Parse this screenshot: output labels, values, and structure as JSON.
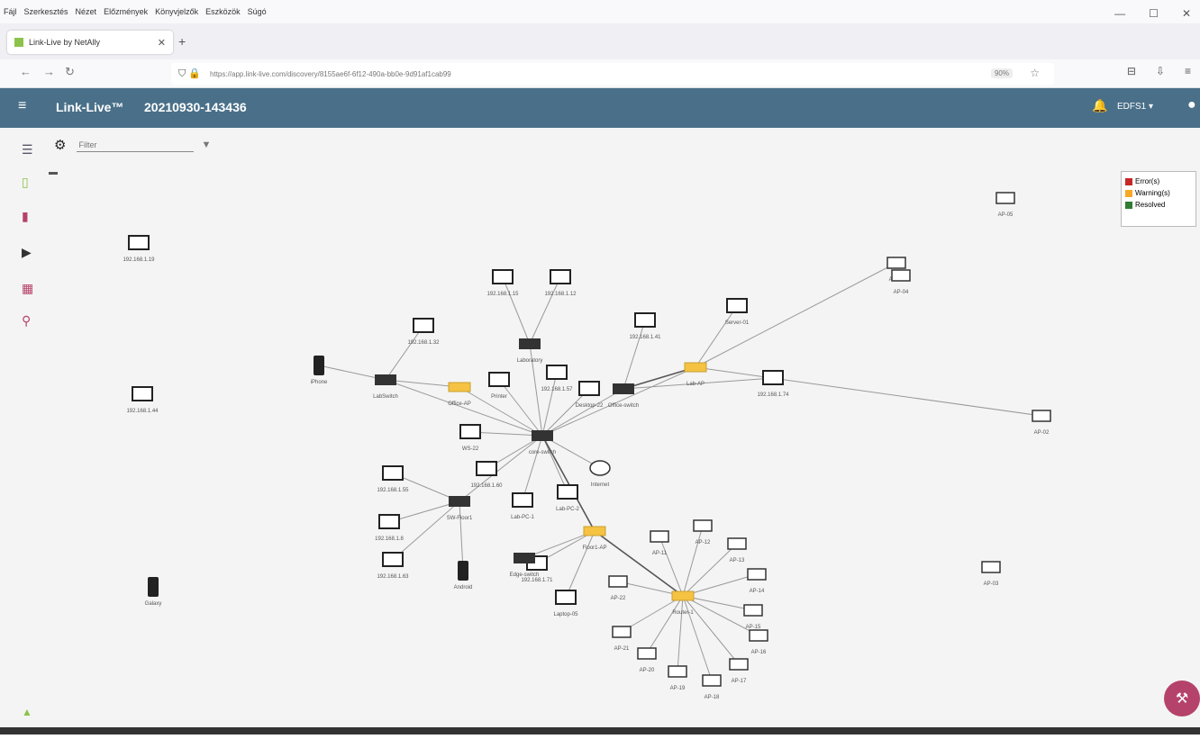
{
  "menubar": {
    "items": [
      "Fájl",
      "Szerkesztés",
      "Nézet",
      "Előzmények",
      "Könyvjelzők",
      "Eszközök",
      "Súgó"
    ]
  },
  "browser": {
    "tab_title": "Link-Live by NetAlly",
    "new_tab": "+",
    "url": "https://app.link-live.com/discovery/8155ae6f-6f12-490a-bb0e-9d91af1cab99",
    "zoom": "90%"
  },
  "app": {
    "brand": "Link-Live™",
    "title": "20210930-143436",
    "user": "EDFS1"
  },
  "filter": {
    "placeholder": "Filter"
  },
  "legend": {
    "items": [
      {
        "label": "Error(s)",
        "color": "#c62828"
      },
      {
        "label": "Warning(s)",
        "color": "#f9a825"
      },
      {
        "label": "Resolved",
        "color": "#2e7d32"
      }
    ]
  },
  "colors": {
    "appbar": "#4a7089",
    "link_normal": "#9a9a9a",
    "link_dark": "#555555",
    "warning": "#f5c242",
    "fab": "#b5426a"
  },
  "graph": {
    "nodes": [
      {
        "id": "core",
        "type": "switch",
        "label": "core-switch"
      },
      {
        "id": "l2",
        "type": "switch",
        "label": "Laboratory"
      },
      {
        "id": "l3",
        "type": "switch",
        "label": "LabSwitch"
      },
      {
        "id": "l4",
        "type": "switch",
        "label": "Office-switch"
      },
      {
        "id": "l5",
        "type": "switch",
        "label": "SW-Floor1"
      },
      {
        "id": "d1",
        "type": "device",
        "label": "192.168.1.15"
      },
      {
        "id": "d2",
        "type": "device",
        "label": "192.168.1.12"
      },
      {
        "id": "d3",
        "type": "device",
        "label": "Printer"
      },
      {
        "id": "d4",
        "type": "device",
        "label": "192.168.1.32"
      },
      {
        "id": "d5",
        "type": "device",
        "label": "192.168.1.41"
      },
      {
        "id": "d6",
        "type": "device",
        "label": "WS-22"
      },
      {
        "id": "d7",
        "type": "device",
        "label": "192.168.1.57"
      },
      {
        "id": "d8",
        "type": "device",
        "label": "Desktop-22"
      },
      {
        "id": "d9",
        "type": "device",
        "label": "192.168.1.60"
      },
      {
        "id": "d10",
        "type": "device",
        "label": "Lab-PC-1"
      },
      {
        "id": "d11",
        "type": "device",
        "label": "Lab-PC-2"
      },
      {
        "id": "d12",
        "type": "device",
        "label": "192.168.1.74"
      },
      {
        "id": "d13",
        "type": "device",
        "label": "Server-01"
      },
      {
        "id": "d14",
        "type": "device",
        "label": "192.168.1.55"
      },
      {
        "id": "d15",
        "type": "device",
        "label": "192.168.1.8"
      },
      {
        "id": "d16",
        "type": "device",
        "label": "192.168.1.63"
      },
      {
        "id": "d17",
        "type": "device",
        "label": "192.168.1.71"
      },
      {
        "id": "d18",
        "type": "device",
        "label": "Laptop-05"
      },
      {
        "id": "d19",
        "type": "device",
        "label": "192.168.1.19"
      },
      {
        "id": "d20",
        "type": "device",
        "label": "192.168.1.44"
      },
      {
        "id": "p1",
        "type": "phone",
        "label": "iPhone"
      },
      {
        "id": "p2",
        "type": "phone",
        "label": "Android"
      },
      {
        "id": "p3",
        "type": "phone",
        "label": "Galaxy"
      },
      {
        "id": "c1",
        "type": "cloud",
        "label": "Internet"
      },
      {
        "id": "w1",
        "type": "wap",
        "label": "Office-AP"
      },
      {
        "id": "w2",
        "type": "wap",
        "label": "Lab-AP"
      },
      {
        "id": "w3",
        "type": "wap",
        "label": "Floor1-AP"
      },
      {
        "id": "a1",
        "type": "ap",
        "label": "AP-01"
      },
      {
        "id": "a2",
        "type": "ap",
        "label": "AP-02"
      },
      {
        "id": "a3",
        "type": "ap",
        "label": "AP-03"
      },
      {
        "id": "a4",
        "type": "ap",
        "label": "AP-04"
      },
      {
        "id": "a5",
        "type": "ap",
        "label": "AP-05"
      },
      {
        "id": "s1",
        "type": "switch",
        "label": "Edge-switch"
      },
      {
        "id": "r1",
        "type": "router",
        "label": "Router-1"
      },
      {
        "id": "ap1",
        "type": "ap",
        "label": "AP-11"
      },
      {
        "id": "ap2",
        "type": "ap",
        "label": "AP-12"
      },
      {
        "id": "ap3",
        "type": "ap",
        "label": "AP-13"
      },
      {
        "id": "ap4",
        "type": "ap",
        "label": "AP-14"
      },
      {
        "id": "ap5",
        "type": "ap",
        "label": "AP-15"
      },
      {
        "id": "ap6",
        "type": "ap",
        "label": "AP-16"
      },
      {
        "id": "ap7",
        "type": "ap",
        "label": "AP-17"
      },
      {
        "id": "ap8",
        "type": "ap",
        "label": "AP-18"
      },
      {
        "id": "ap9",
        "type": "ap",
        "label": "AP-19"
      },
      {
        "id": "ap10",
        "type": "ap",
        "label": "AP-20"
      },
      {
        "id": "ap11",
        "type": "ap",
        "label": "AP-21"
      },
      {
        "id": "ap12",
        "type": "ap",
        "label": "AP-22"
      }
    ],
    "links": [
      [
        "core",
        "l2"
      ],
      [
        "core",
        "l3"
      ],
      [
        "core",
        "l4"
      ],
      [
        "core",
        "l5"
      ],
      [
        "core",
        "d3"
      ],
      [
        "core",
        "d6"
      ],
      [
        "core",
        "d7"
      ],
      [
        "core",
        "d8"
      ],
      [
        "core",
        "d9"
      ],
      [
        "core",
        "d10"
      ],
      [
        "core",
        "d11"
      ],
      [
        "core",
        "c1"
      ],
      [
        "core",
        "w1"
      ],
      [
        "core",
        "w2"
      ],
      [
        "l2",
        "d1"
      ],
      [
        "l2",
        "d2"
      ],
      [
        "l3",
        "p1"
      ],
      [
        "l3",
        "w1"
      ],
      [
        "l3",
        "d4"
      ],
      [
        "l4",
        "d5"
      ],
      [
        "l4",
        "w2"
      ],
      [
        "l4",
        "d12"
      ],
      [
        "w2",
        "a1"
      ],
      [
        "w2",
        "a2"
      ],
      [
        "w2",
        "d13"
      ],
      [
        "l5",
        "d14"
      ],
      [
        "l5",
        "d15"
      ],
      [
        "l5",
        "d16"
      ],
      [
        "l5",
        "p2"
      ],
      [
        "w3",
        "r1"
      ],
      [
        "w3",
        "d17"
      ],
      [
        "w3",
        "d18"
      ],
      [
        "w3",
        "s1"
      ],
      [
        "core",
        "w3"
      ],
      [
        "r1",
        "ap1"
      ],
      [
        "r1",
        "ap2"
      ],
      [
        "r1",
        "ap3"
      ],
      [
        "r1",
        "ap4"
      ],
      [
        "r1",
        "ap5"
      ],
      [
        "r1",
        "ap6"
      ],
      [
        "r1",
        "ap7"
      ],
      [
        "r1",
        "ap8"
      ],
      [
        "r1",
        "ap9"
      ],
      [
        "r1",
        "ap10"
      ],
      [
        "r1",
        "ap11"
      ],
      [
        "r1",
        "ap12"
      ]
    ]
  }
}
